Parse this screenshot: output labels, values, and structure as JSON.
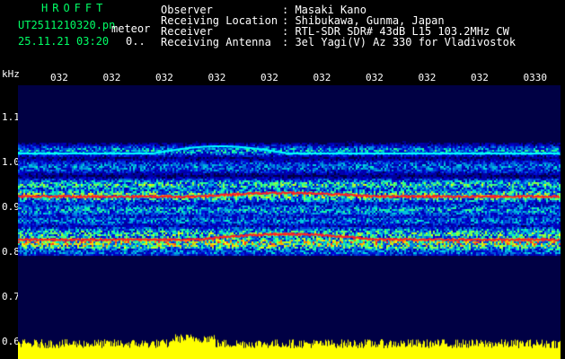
{
  "header": {
    "title": "HROFFT",
    "filename": "UT2511210320.pn",
    "meteor_label": "meteor",
    "datetime": "25.11.21 03:20",
    "counter": "0.."
  },
  "info": {
    "rows": [
      {
        "label": "Observer",
        "value": ": Masaki Kano"
      },
      {
        "label": "Receiving Location",
        "value": ": Shibukawa, Gunma, Japan"
      },
      {
        "label": "Receiver",
        "value": ": RTL-SDR SDR# 43dB L15 103.2MHz CW"
      },
      {
        "label": "Receiving Antenna",
        "value": ": 3el Yagi(V) Az 330 for Vladivostok"
      }
    ]
  },
  "axes": {
    "unit": "kHz",
    "x_ticks": [
      "032",
      "032",
      "032",
      "032",
      "032",
      "032",
      "032",
      "032",
      "032",
      "0330"
    ],
    "y_ticks": [
      "1.1",
      "1.0",
      "0.9",
      "0.8",
      "0.7",
      "0.6"
    ]
  },
  "colors": {
    "header_green": "#00ff66",
    "background": "#000000",
    "plot_bg": "#000044",
    "signal_cyan": "#00ffff",
    "signal_red": "#ff2222",
    "noise_yellow": "#ffff00"
  }
}
